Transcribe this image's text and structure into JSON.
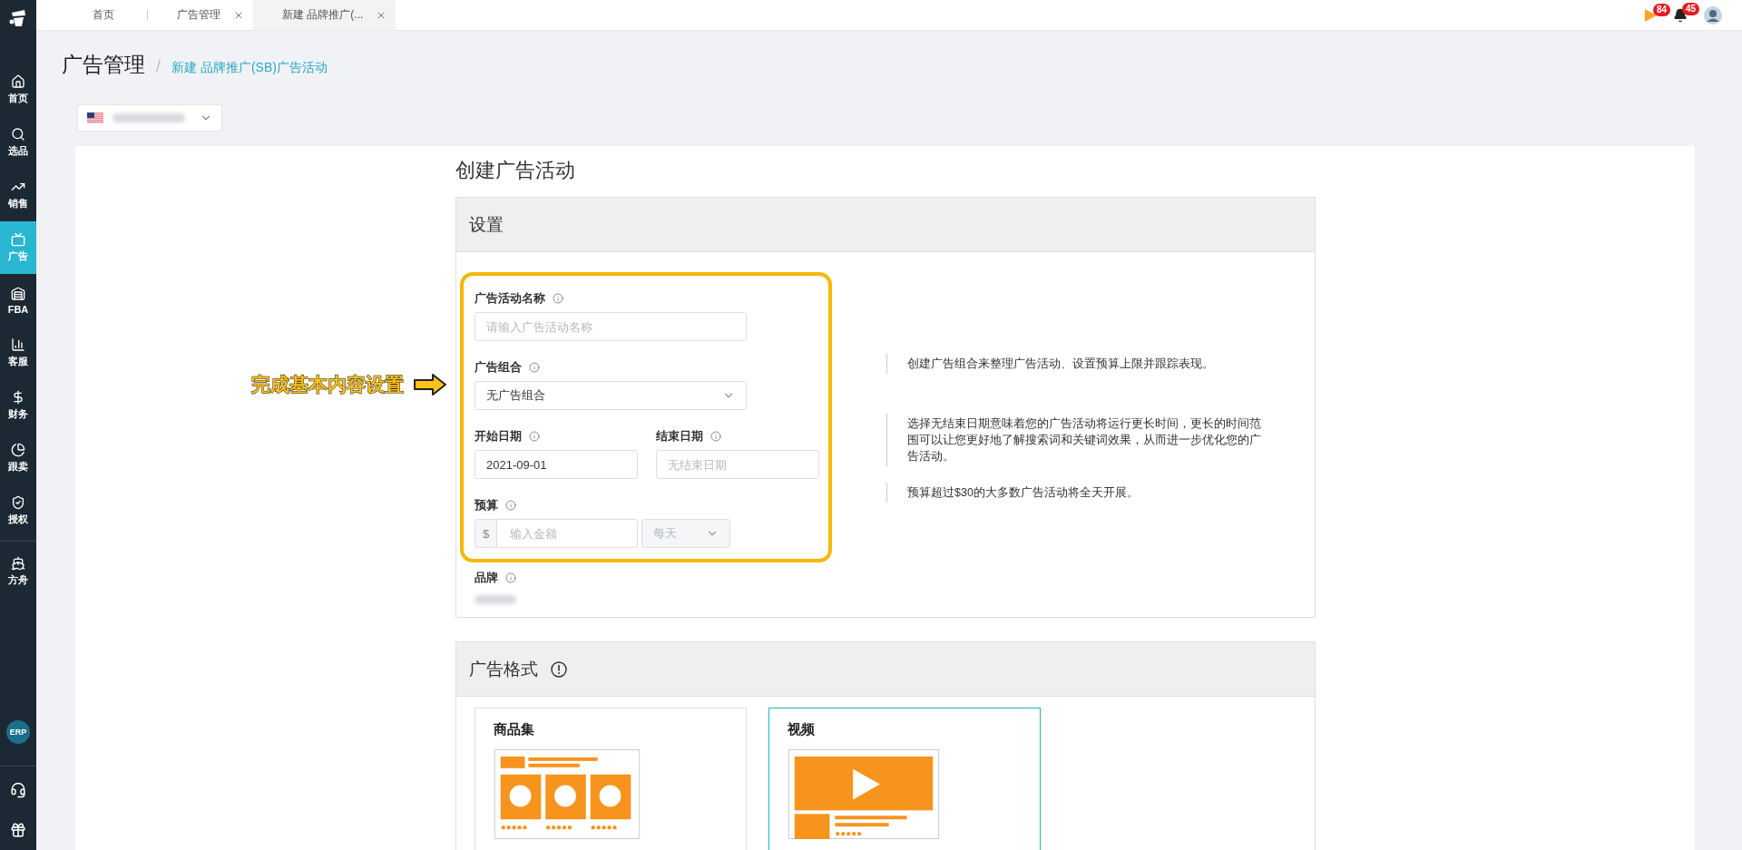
{
  "tabs": [
    {
      "label": "首页",
      "closable": false,
      "selected": false
    },
    {
      "label": "广告管理",
      "closable": true,
      "selected": false
    },
    {
      "label": "新建 品牌推广(...",
      "closable": true,
      "selected": true
    }
  ],
  "notifications": [
    {
      "count": "84"
    },
    {
      "count": "45"
    }
  ],
  "sidebar": {
    "items": [
      {
        "label": "首页",
        "selected": false
      },
      {
        "label": "选品",
        "selected": false
      },
      {
        "label": "销售",
        "selected": false
      },
      {
        "label": "广告",
        "selected": true
      },
      {
        "label": "FBA",
        "selected": false
      },
      {
        "label": "客服",
        "selected": false
      },
      {
        "label": "财务",
        "selected": false
      },
      {
        "label": "跟卖",
        "selected": false
      },
      {
        "label": "授权",
        "selected": false
      },
      {
        "label": "方舟",
        "selected": false
      }
    ],
    "erp_badge": "ERP"
  },
  "page_title": "广告管理",
  "breadcrumb_separator": "/",
  "breadcrumb": "新建 品牌推广(SB)广告活动",
  "form_title": "创建广告活动",
  "settings": {
    "title": "设置",
    "annotation": "完成基本内容设置",
    "campaign_name": {
      "label": "广告活动名称",
      "placeholder": "请输入广告活动名称"
    },
    "portfolio": {
      "label": "广告组合",
      "value": "无广告组合"
    },
    "start_date": {
      "label": "开始日期",
      "value": "2021-09-01"
    },
    "end_date": {
      "label": "结束日期",
      "placeholder": "无结束日期"
    },
    "budget": {
      "label": "预算",
      "currency": "$",
      "placeholder": "输入金额",
      "period": "每天",
      "period_disabled": true
    },
    "brand": {
      "label": "品牌"
    },
    "hints": [
      "创建广告组合来整理广告活动、设置预算上限并跟踪表现。",
      "选择无结束日期意味着您的广告活动将运行更长时间，更长的时间范围可以让您更好地了解搜索词和关键词效果，从而进一步优化您的广告活动。",
      "预算超过$30的大多数广告活动将全天开展。"
    ]
  },
  "ad_format": {
    "title": "广告格式",
    "options": [
      {
        "title": "商品集",
        "selected": false
      },
      {
        "title": "视频",
        "selected": true
      }
    ]
  }
}
